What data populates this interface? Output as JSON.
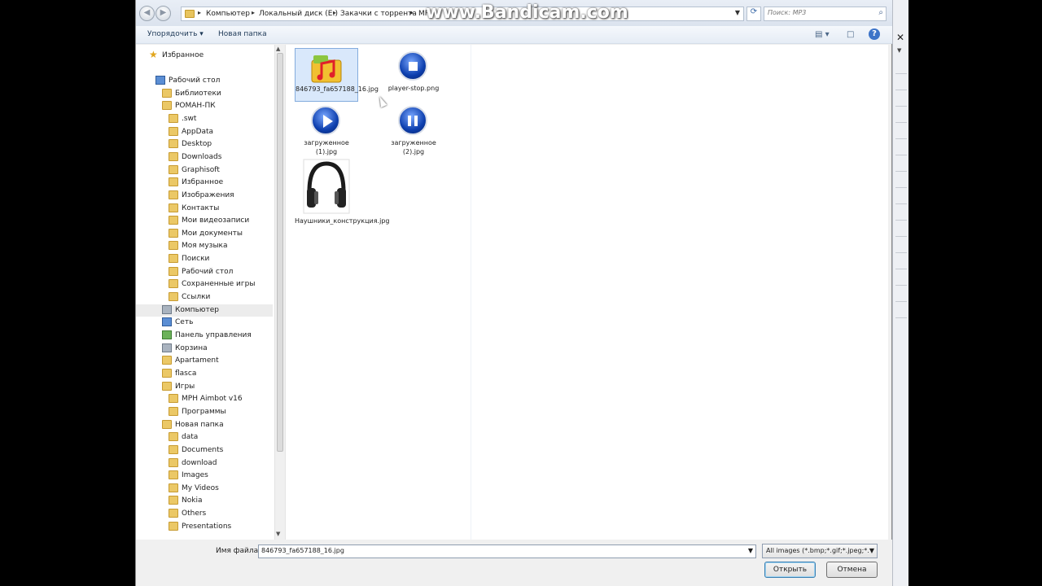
{
  "watermark": "www.Bandicam.com",
  "address": {
    "crumbs": [
      "Компьютер",
      "Локальный диск (E:)",
      "Закачки с торрента",
      "MP"
    ]
  },
  "search": {
    "placeholder": "Поиск: MP3"
  },
  "toolbar": {
    "organize": "Упорядочить ▾",
    "new_folder": "Новая папка",
    "help": "?"
  },
  "nav": {
    "favorites": "Избранное",
    "items": [
      {
        "label": "Рабочий стол",
        "icon": "desktop-icon"
      },
      {
        "label": "Библиотеки",
        "icon": "library-icon"
      },
      {
        "label": "РОМАН-ПК",
        "icon": "user-folder-icon"
      },
      {
        "label": ".swt",
        "icon": "folder-icon"
      },
      {
        "label": "AppData",
        "icon": "folder-icon"
      },
      {
        "label": "Desktop",
        "icon": "folder-icon"
      },
      {
        "label": "Downloads",
        "icon": "folder-icon"
      },
      {
        "label": "Graphisoft",
        "icon": "folder-icon"
      },
      {
        "label": "Избранное",
        "icon": "folder-icon"
      },
      {
        "label": "Изображения",
        "icon": "folder-icon"
      },
      {
        "label": "Контакты",
        "icon": "folder-icon"
      },
      {
        "label": "Мои видеозаписи",
        "icon": "folder-icon"
      },
      {
        "label": "Мои документы",
        "icon": "folder-icon"
      },
      {
        "label": "Моя музыка",
        "icon": "folder-icon"
      },
      {
        "label": "Поиски",
        "icon": "folder-icon"
      },
      {
        "label": "Рабочий стол",
        "icon": "folder-icon"
      },
      {
        "label": "Сохраненные игры",
        "icon": "folder-icon"
      },
      {
        "label": "Ссылки",
        "icon": "folder-icon"
      },
      {
        "label": "Компьютер",
        "icon": "computer-icon"
      },
      {
        "label": "Сеть",
        "icon": "network-icon"
      },
      {
        "label": "Панель управления",
        "icon": "control-panel-icon"
      },
      {
        "label": "Корзина",
        "icon": "recycle-bin-icon"
      },
      {
        "label": "Apartament",
        "icon": "folder-icon"
      },
      {
        "label": "flasca",
        "icon": "folder-icon"
      },
      {
        "label": "Игры",
        "icon": "folder-icon"
      },
      {
        "label": "MPH Aimbot v16",
        "icon": "folder-icon"
      },
      {
        "label": "Программы",
        "icon": "folder-icon"
      },
      {
        "label": "Новая папка",
        "icon": "folder-icon"
      },
      {
        "label": "data",
        "icon": "folder-icon"
      },
      {
        "label": "Documents",
        "icon": "folder-icon"
      },
      {
        "label": "download",
        "icon": "folder-icon"
      },
      {
        "label": "Images",
        "icon": "folder-icon"
      },
      {
        "label": "My Videos",
        "icon": "folder-icon"
      },
      {
        "label": "Nokia",
        "icon": "folder-icon"
      },
      {
        "label": "Others",
        "icon": "folder-icon"
      },
      {
        "label": "Presentations",
        "icon": "folder-icon"
      }
    ]
  },
  "files": [
    {
      "name": "846793_fa657188_16.jpg",
      "icon": "music-folder-image-icon",
      "selected": true
    },
    {
      "name": "player-stop.png",
      "icon": "stop-button-image-icon"
    },
    {
      "name": "загруженное (1).jpg",
      "icon": "play-button-image-icon"
    },
    {
      "name": "загруженное (2).jpg",
      "icon": "pause-button-image-icon"
    },
    {
      "name": "Наушники_конструкция.jpg",
      "icon": "headphones-image-icon"
    }
  ],
  "bottom": {
    "filename_label": "Имя файла:",
    "filename_value": "846793_fa657188_16.jpg",
    "filter": "All images (*.bmp;*.gif;*.jpeg;*.",
    "open": "Открыть",
    "cancel": "Отмена"
  },
  "colors": {
    "selection": "#d9e8fb",
    "accent": "#3d74c8"
  }
}
